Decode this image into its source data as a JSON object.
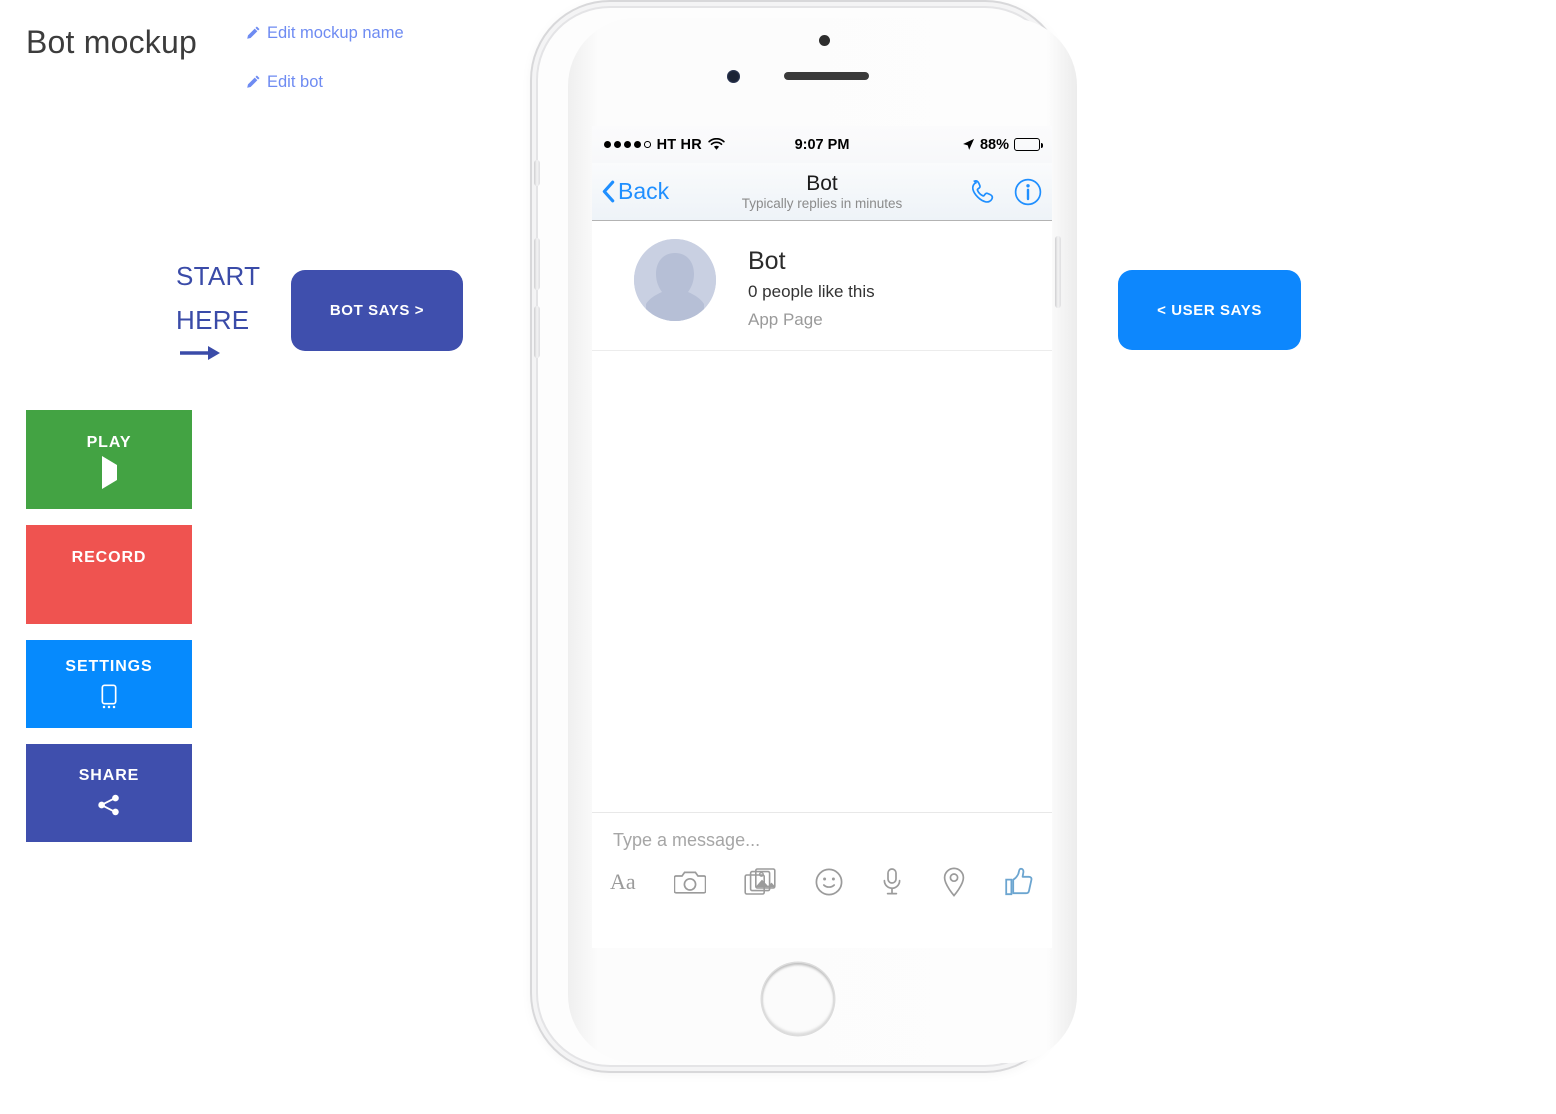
{
  "page": {
    "title": "Bot mockup",
    "edit_links": [
      {
        "label": "Edit mockup name",
        "icon": "pencil-icon"
      },
      {
        "label": "Edit bot",
        "icon": "pencil-icon"
      }
    ]
  },
  "annotations": {
    "start_here_line1": "START",
    "start_here_line2": "HERE",
    "arrow_icon": "arrow-right-icon"
  },
  "buttons": {
    "bot_says": {
      "label": "BOT SAYS >",
      "color": "#3f4fad"
    },
    "user_says": {
      "label": "< USER SAYS",
      "color": "#0d87fd"
    },
    "play": {
      "label": "PLAY",
      "icon": "play-triangle-icon",
      "color": "#43a343"
    },
    "record": {
      "label": "RECORD",
      "icon": "record-dot-icon",
      "color": "#ef5350"
    },
    "settings": {
      "label": "SETTINGS",
      "icon": "mobile-phone-icon",
      "color": "#068afd"
    },
    "share": {
      "label": "SHARE",
      "icon": "share-nodes-icon",
      "color": "#3f4fad"
    }
  },
  "phone": {
    "status_bar": {
      "signal_dots_filled": 4,
      "signal_dots_empty": 1,
      "wifi_icon": "wifi-icon",
      "carrier": "HT HR",
      "time": "9:07 PM",
      "location_icon": "location-arrow-icon",
      "battery_percent": "88%",
      "battery_level": 88
    },
    "navbar": {
      "back_label": "Back",
      "back_icon": "chevron-left-icon",
      "title": "Bot",
      "subtitle": "Typically replies in minutes",
      "call_icon": "phone-handset-icon",
      "info_icon": "info-circle-icon"
    },
    "profile": {
      "avatar_icon": "user-silhouette-avatar",
      "name": "Bot",
      "likes": "0 people like this",
      "category": "App Page"
    },
    "composer": {
      "placeholder": "Type a message...",
      "value": "",
      "icons": [
        {
          "name": "text-format-icon",
          "glyph": "Aa"
        },
        {
          "name": "camera-icon"
        },
        {
          "name": "photo-gallery-icon"
        },
        {
          "name": "emoji-smiley-icon"
        },
        {
          "name": "microphone-icon"
        },
        {
          "name": "location-pin-icon"
        },
        {
          "name": "thumbs-up-icon"
        }
      ]
    }
  },
  "colors": {
    "ios_blue": "#1f8fff",
    "link_blue": "#6e8bf2",
    "indigo": "#3f4fad",
    "thumbs_up_blue": "#6ca5d0"
  }
}
